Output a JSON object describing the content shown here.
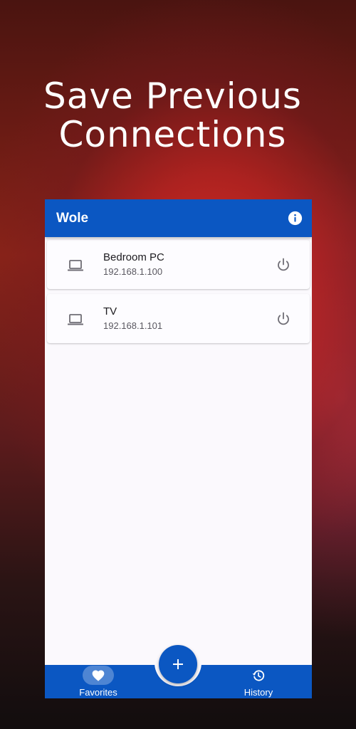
{
  "headline": {
    "line1": "Save Previous",
    "line2": "Connections"
  },
  "app": {
    "title": "Wole"
  },
  "devices": [
    {
      "name": "Bedroom PC",
      "ip": "192.168.1.100"
    },
    {
      "name": "TV",
      "ip": "192.168.1.101"
    }
  ],
  "bottom_nav": {
    "favorites_label": "Favorites",
    "history_label": "History",
    "selected": "Favorites"
  },
  "colors": {
    "primary": "#0b57c2",
    "surface": "#fbf9fd",
    "icon_gray": "#6f6d75"
  },
  "icons": {
    "info": "info-icon",
    "device": "laptop-icon",
    "power": "power-icon",
    "add": "plus-icon",
    "favorites": "heart-icon",
    "history": "history-icon"
  }
}
